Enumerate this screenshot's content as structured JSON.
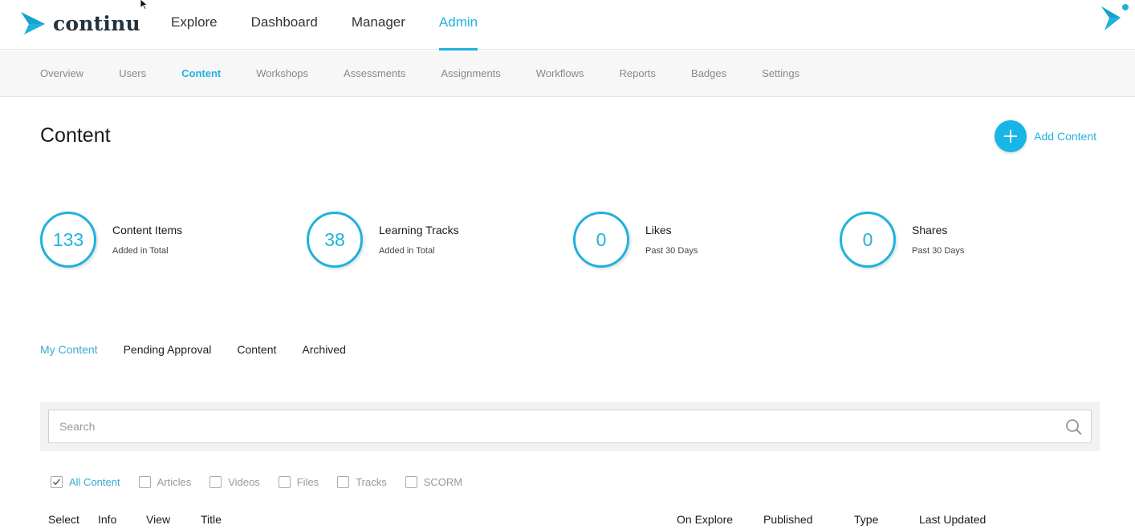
{
  "brand": {
    "name": "continu",
    "accent": "#1fb2dc",
    "logo_icon": "continu-arrow-icon"
  },
  "topnav": [
    {
      "label": "Explore",
      "active": false
    },
    {
      "label": "Dashboard",
      "active": false
    },
    {
      "label": "Manager",
      "active": false
    },
    {
      "label": "Admin",
      "active": true
    }
  ],
  "subnav": [
    {
      "label": "Overview",
      "active": false
    },
    {
      "label": "Users",
      "active": false
    },
    {
      "label": "Content",
      "active": true
    },
    {
      "label": "Workshops",
      "active": false
    },
    {
      "label": "Assessments",
      "active": false
    },
    {
      "label": "Assignments",
      "active": false
    },
    {
      "label": "Workflows",
      "active": false
    },
    {
      "label": "Reports",
      "active": false
    },
    {
      "label": "Badges",
      "active": false
    },
    {
      "label": "Settings",
      "active": false
    }
  ],
  "header": {
    "title": "Content",
    "add_label": "Add Content",
    "add_icon": "plus-icon"
  },
  "stats": [
    {
      "value": "133",
      "label": "Content Items",
      "sub": "Added in Total"
    },
    {
      "value": "38",
      "label": "Learning Tracks",
      "sub": "Added in Total"
    },
    {
      "value": "0",
      "label": "Likes",
      "sub": "Past 30 Days"
    },
    {
      "value": "0",
      "label": "Shares",
      "sub": "Past 30 Days"
    }
  ],
  "tabs": [
    {
      "label": "My Content",
      "active": true
    },
    {
      "label": "Pending Approval",
      "active": false
    },
    {
      "label": "Content",
      "active": false
    },
    {
      "label": "Archived",
      "active": false
    }
  ],
  "search": {
    "placeholder": "Search",
    "value": "",
    "icon": "search-icon"
  },
  "filters": [
    {
      "label": "All Content",
      "checked": true
    },
    {
      "label": "Articles",
      "checked": false
    },
    {
      "label": "Videos",
      "checked": false
    },
    {
      "label": "Files",
      "checked": false
    },
    {
      "label": "Tracks",
      "checked": false
    },
    {
      "label": "SCORM",
      "checked": false
    }
  ],
  "table": {
    "columns": [
      "Select",
      "Info",
      "View",
      "Title",
      "On Explore",
      "Published",
      "Type",
      "Last Updated"
    ]
  }
}
